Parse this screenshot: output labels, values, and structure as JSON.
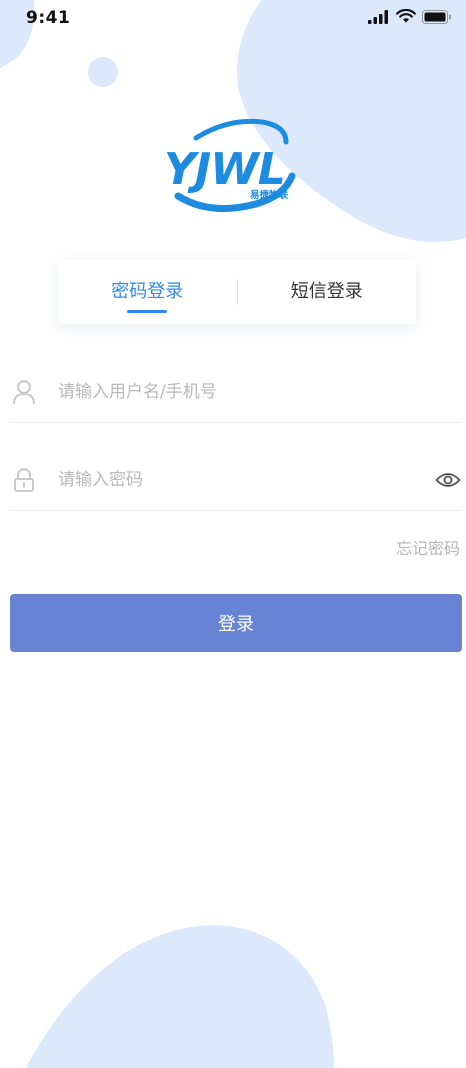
{
  "status_bar": {
    "time": "9:41"
  },
  "logo": {
    "text": "YJWL",
    "subtext": "易捷物联",
    "brand_color": "#1c8be0"
  },
  "tabs": [
    {
      "label": "密码登录",
      "active": true
    },
    {
      "label": "短信登录",
      "active": false
    }
  ],
  "form": {
    "username": {
      "placeholder": "请输入用户名/手机号",
      "value": "",
      "icon": "user-icon"
    },
    "password": {
      "placeholder": "请输入密码",
      "value": "",
      "icon": "lock-icon",
      "toggle_icon": "eye-icon"
    },
    "forgot_label": "忘记密码",
    "login_label": "登录"
  },
  "colors": {
    "accent": "#2d8cf0",
    "button": "#6882d4",
    "background_blob": "#dbe9fb"
  }
}
